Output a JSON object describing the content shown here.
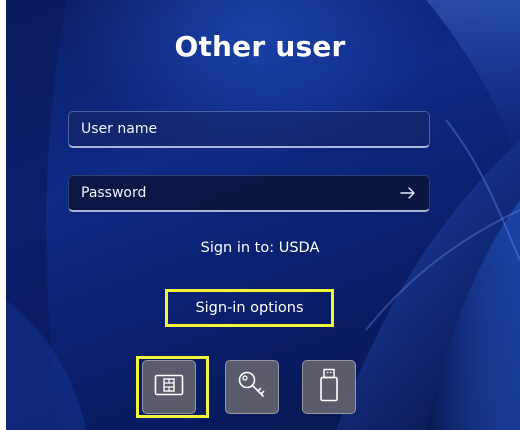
{
  "login": {
    "title": "Other user",
    "username_placeholder": "User name",
    "password_placeholder": "Password",
    "submit_icon": "arrow-right-icon",
    "sign_in_to": "Sign in to: USDA",
    "sign_in_options_label": "Sign-in options"
  },
  "sign_in_options": [
    {
      "icon": "smart-card-icon",
      "selected": true
    },
    {
      "icon": "key-icon",
      "selected": false
    },
    {
      "icon": "usb-security-key-icon",
      "selected": false
    }
  ],
  "colors": {
    "background": "#0d2a86",
    "highlight": "#f5f53a",
    "option_button": "#5f626c",
    "text": "#ffffff"
  }
}
